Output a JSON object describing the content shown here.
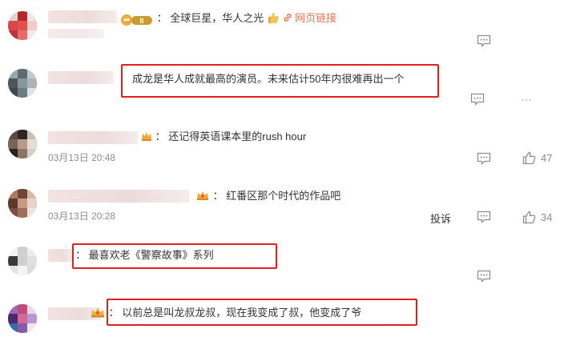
{
  "comments": [
    {
      "sep": "：",
      "text": "全球巨星，华人之光",
      "link_label": "网页链接"
    },
    {
      "sep": "",
      "text": "成龙是华人成就最高的演员。未来估计50年内很难再出一个"
    },
    {
      "sep": "：",
      "text": "还记得英语课本里的rush hour",
      "time": "03月13日 20:48",
      "likes": "47"
    },
    {
      "sep": "：",
      "text": "红番区那个时代的作品吧",
      "time": "03月13日 20:28",
      "likes": "34",
      "report_label": "投诉"
    },
    {
      "sep": "：",
      "text": "最喜欢老《警察故事》系列"
    },
    {
      "sep": "：",
      "text": "以前总是叫龙叔龙叔，现在我变成了叔，他变成了爷"
    }
  ],
  "icons": {
    "comment": "comment-bubble-icon",
    "like": "thumbs-up-icon",
    "link": "link-icon",
    "thumb_emoji": "thumbs-up-emoji",
    "crown": "crown-badge-icon",
    "vip": "vip-badge-icon"
  },
  "colors": {
    "highlight_box": "#e0201f",
    "link": "#eb7350",
    "timestamp": "#8d8d8d"
  }
}
